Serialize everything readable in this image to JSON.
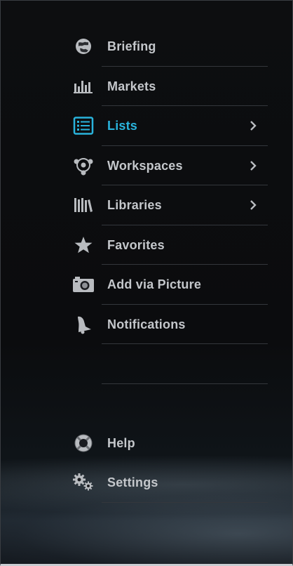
{
  "menu": {
    "items": [
      {
        "label": "Briefing",
        "icon": "globe-icon"
      },
      {
        "label": "Markets",
        "icon": "bar-chart-icon"
      },
      {
        "label": "Lists",
        "icon": "list-icon",
        "active": true,
        "chevron": true
      },
      {
        "label": "Workspaces",
        "icon": "network-icon",
        "chevron": true
      },
      {
        "label": "Libraries",
        "icon": "books-icon",
        "chevron": true
      },
      {
        "label": "Favorites",
        "icon": "star-icon"
      },
      {
        "label": "Add via Picture",
        "icon": "camera-icon"
      },
      {
        "label": "Notifications",
        "icon": "bell-icon"
      }
    ],
    "bottom_items": [
      {
        "label": "Help",
        "icon": "lifebuoy-icon"
      },
      {
        "label": "Settings",
        "icon": "gears-icon"
      }
    ]
  },
  "colors": {
    "accent": "#29b3dc",
    "text": "#c4c7cb",
    "divider": "#34373c",
    "background": "#0b0c0e"
  }
}
